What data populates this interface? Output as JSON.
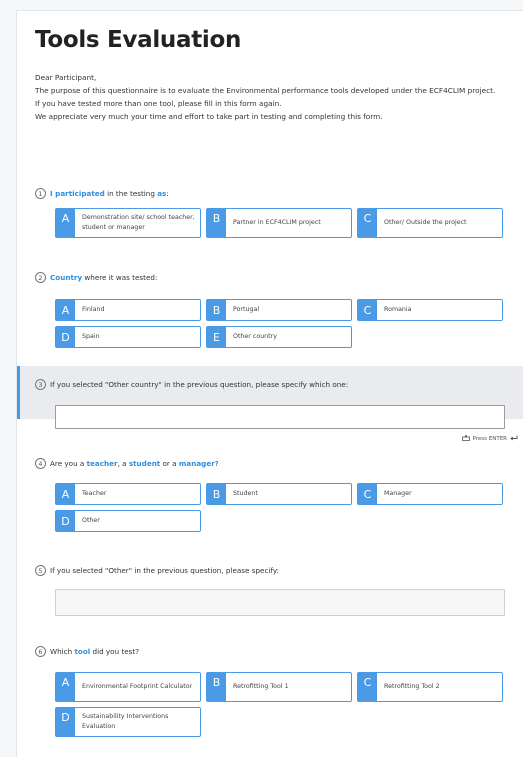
{
  "title": "Tools Evaluation",
  "intro": [
    "Dear Participant,",
    "The purpose of this questionnaire is to evaluate the Environmental performance tools developed under the ECF4CLIM project.",
    "If you have tested more than one tool, please fill in this form again.",
    "We appreciate very much your time and effort to take part in testing and completing this form."
  ],
  "questions": [
    {
      "number": "1",
      "parts": [
        {
          "text": "I participated",
          "highlight": true
        },
        {
          "text": " in the testing ",
          "highlight": false
        },
        {
          "text": "as",
          "highlight": true
        },
        {
          "text": ":",
          "highlight": false
        }
      ],
      "options": [
        {
          "letter": "A",
          "label": "Demonstration site/ school teacher, student or manager"
        },
        {
          "letter": "B",
          "label": "Partner in ECF4CLIM project"
        },
        {
          "letter": "C",
          "label": "Other/ Outside the project"
        }
      ]
    },
    {
      "number": "2",
      "parts": [
        {
          "text": "Country",
          "highlight": true
        },
        {
          "text": " where it was tested:",
          "highlight": false
        }
      ],
      "options": [
        {
          "letter": "A",
          "label": "Finland"
        },
        {
          "letter": "B",
          "label": "Portugal"
        },
        {
          "letter": "C",
          "label": "Romania"
        },
        {
          "letter": "D",
          "label": "Spain"
        },
        {
          "letter": "E",
          "label": "Other country"
        }
      ]
    },
    {
      "number": "3",
      "parts": [
        {
          "text": "If you selected \"Other country\" in the previous question, please specify which one:",
          "highlight": false
        }
      ],
      "value": "",
      "placeholder": ""
    },
    {
      "number": "4",
      "parts": [
        {
          "text": "Are you a ",
          "highlight": false
        },
        {
          "text": "teacher",
          "highlight": true
        },
        {
          "text": ", a ",
          "highlight": false
        },
        {
          "text": "student",
          "highlight": true
        },
        {
          "text": " or a ",
          "highlight": false
        },
        {
          "text": "manager",
          "highlight": true
        },
        {
          "text": "?",
          "highlight": false
        }
      ],
      "options": [
        {
          "letter": "A",
          "label": "Teacher"
        },
        {
          "letter": "B",
          "label": "Student"
        },
        {
          "letter": "C",
          "label": "Manager"
        },
        {
          "letter": "D",
          "label": "Other"
        }
      ]
    },
    {
      "number": "5",
      "parts": [
        {
          "text": "If you selected \"Other\" in the previous question, please specify:",
          "highlight": false
        }
      ],
      "value": "",
      "placeholder": ""
    },
    {
      "number": "6",
      "parts": [
        {
          "text": "Which ",
          "highlight": false
        },
        {
          "text": "tool",
          "highlight": true
        },
        {
          "text": " did you test?",
          "highlight": false
        }
      ],
      "options": [
        {
          "letter": "A",
          "label": "Environmental Footprint Calculator"
        },
        {
          "letter": "B",
          "label": "Retrofitting Tool 1"
        },
        {
          "letter": "C",
          "label": "Retrofitting Tool 2"
        },
        {
          "letter": "D",
          "label": "Sustainability Interventions Evaluation"
        }
      ]
    }
  ],
  "press_enter_label": "Press ENTER",
  "icons": {
    "keyboard": "keyboard-icon",
    "enter": "enter-arrow-icon"
  },
  "colors": {
    "accent": "#4a9ae6",
    "highlight_text": "#2f8ee0",
    "active_band": "#e9ebee"
  }
}
